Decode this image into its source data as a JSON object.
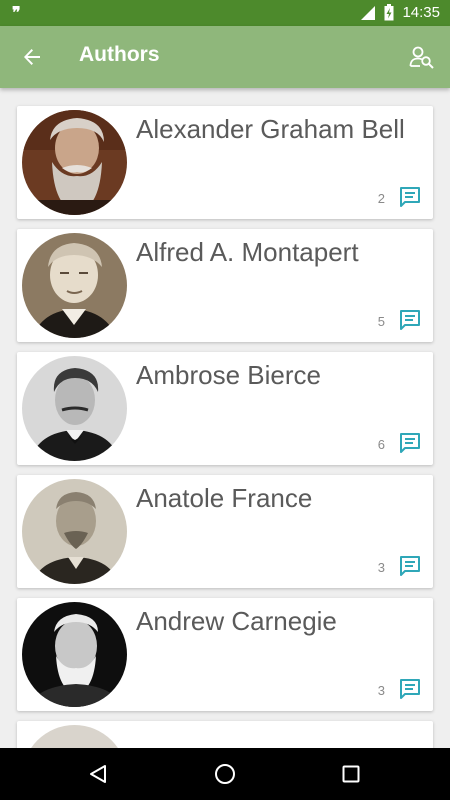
{
  "status_bar": {
    "time": "14:35"
  },
  "app_bar": {
    "title": "Authors"
  },
  "authors": [
    {
      "name": "Alexander Graham Bell",
      "quote_count": "2"
    },
    {
      "name": "Alfred A. Montapert",
      "quote_count": "5"
    },
    {
      "name": "Ambrose Bierce",
      "quote_count": "6"
    },
    {
      "name": "Anatole France",
      "quote_count": "3"
    },
    {
      "name": "Andrew Carnegie",
      "quote_count": "3"
    }
  ],
  "colors": {
    "status_bar": "#4d8a2c",
    "app_bar": "#8fb77b",
    "accent_icon": "#2fa7b8",
    "name_text": "#5a5a5a"
  },
  "icons": {
    "back": "arrow-left-icon",
    "search": "person-search-icon",
    "quote": "quote-comment-icon"
  }
}
